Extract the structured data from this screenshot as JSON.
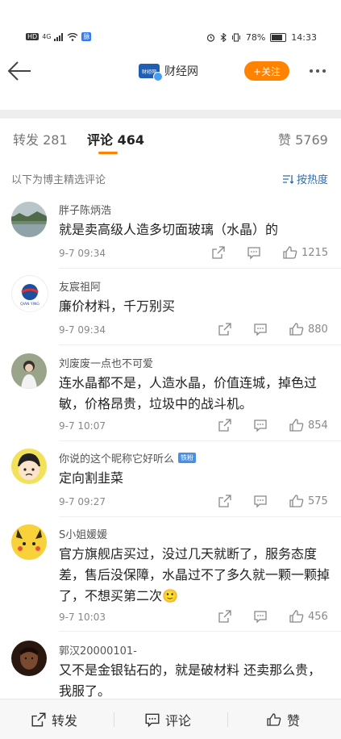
{
  "status": {
    "hd": "HD",
    "network": "4G",
    "speed_badge": "脉",
    "battery_pct": "78%",
    "time": "14:33",
    "battery_level": 0.78
  },
  "header": {
    "account_name": "财经网",
    "logo_text": "财经网",
    "follow_label": "+关注"
  },
  "tabs": {
    "repost": "转发 281",
    "comments": "评论 464",
    "likes": "赞 5769"
  },
  "sort": {
    "label": "以下为博主精选评论",
    "button": "按热度"
  },
  "comments": [
    {
      "name": "胖子陈炳浩",
      "text": "就是卖高级人造多切面玻璃（水晶）的",
      "time": "9-7 09:34",
      "likes": "1215"
    },
    {
      "name": "友宸祖阿",
      "text": "廉价材料，千万别买",
      "time": "9-7 09:34",
      "likes": "880"
    },
    {
      "name": "刘废废一点也不可爱",
      "text": "连水晶都不是，人造水晶，价值连城，掉色过敏，价格昂贵，垃圾中的战斗机。",
      "time": "9-7 10:07",
      "likes": "854"
    },
    {
      "name": "你说的这个昵称它好听么",
      "badge": "铁粉",
      "text": "定向割韭菜",
      "time": "9-7 09:27",
      "likes": "575"
    },
    {
      "name": "S小姐媛媛",
      "text": "官方旗舰店买过，没过几天就断了，服务态度差，售后没保障，水晶过不了多久就一颗一颗掉了，不想买第二次🙂",
      "time": "9-7 10:03",
      "likes": "456"
    },
    {
      "name": "郭汉20000101-",
      "text": "又不是金银钻石的，就是破材料 还卖那么贵，我服了。",
      "time": "",
      "likes": ""
    }
  ],
  "avatar_logo_text": "QIAN YING",
  "bottom": {
    "repost": "转发",
    "comment": "评论",
    "like": "赞"
  },
  "colors": {
    "accent": "#ff8200",
    "link": "#2a6db8",
    "verified": "#4a9cf0"
  }
}
